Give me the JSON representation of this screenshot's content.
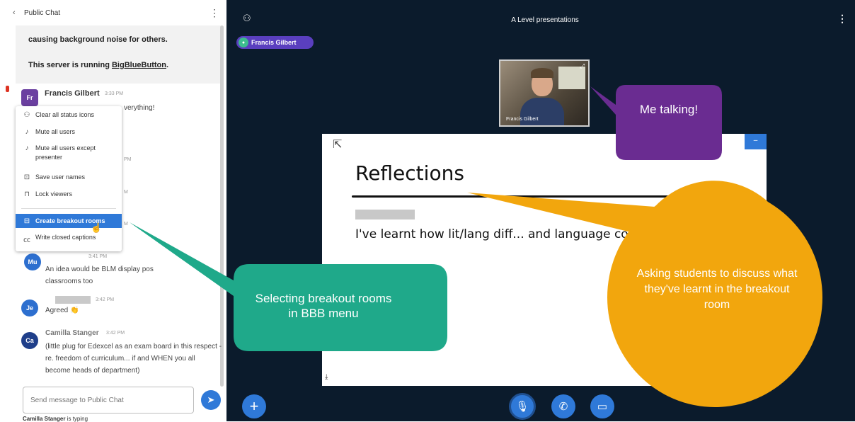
{
  "chat": {
    "back_label": "Public Chat",
    "system_line1": "causing background noise for others.",
    "system_line2_prefix": "This server is running ",
    "system_link": "BigBlueButton",
    "system_line2_suffix": ".",
    "messages": [
      {
        "initials": "Fr",
        "name": "Francis Gilbert",
        "time": "3:33 PM",
        "text": "verything!"
      },
      {
        "initials": "Mu",
        "name": "",
        "time": "3:41 PM",
        "text": "An idea would be BLM display pos classrooms too"
      },
      {
        "initials": "Je",
        "name": "",
        "time": "3:42 PM",
        "text": "Agreed 👏"
      },
      {
        "initials": "Ca",
        "name": "Camilla Stanger",
        "time": "3:42 PM",
        "text": "(little plug for Edexcel as an exam board in this respect - re. freedom of curriculum... if and WHEN you all become heads of department)"
      }
    ],
    "frag_pm": "PM",
    "frag_m1": "M",
    "frag_m2": "M",
    "input_placeholder": "Send message to Public Chat",
    "typing_name": "Camilla Stanger",
    "typing_suffix": " is typing"
  },
  "menu": {
    "items": [
      {
        "label": "Clear all status icons",
        "icon": "status-clear-icon"
      },
      {
        "label": "Mute all users",
        "icon": "mute-icon"
      },
      {
        "label": "Mute all users except presenter",
        "icon": "mute-except-icon"
      },
      {
        "label": "Save user names",
        "icon": "save-icon"
      },
      {
        "label": "Lock viewers",
        "icon": "lock-icon"
      },
      {
        "label": "Create breakout rooms",
        "icon": "breakout-icon",
        "highlighted": true
      },
      {
        "label": "Write closed captions",
        "icon": "cc-icon"
      }
    ]
  },
  "presentation": {
    "title": "A Level presentations",
    "talker": "Francis Gilbert",
    "webcam_name": "Francis Gilbert",
    "slide_title": "Reflections",
    "slide_body": "I've learnt how lit/lang diff... and language course at A-leve..."
  },
  "annotations": {
    "me": "Me talking!",
    "green": "Selecting breakout rooms in BBB menu",
    "orange": "Asking students to discuss what they've learnt in the breakout room"
  },
  "colors": {
    "accent": "#2f79d8",
    "main_bg": "#0b1b2c",
    "purple_callout": "#6a2c91",
    "green_callout": "#1fa98a",
    "orange_callout": "#f2a60d"
  }
}
